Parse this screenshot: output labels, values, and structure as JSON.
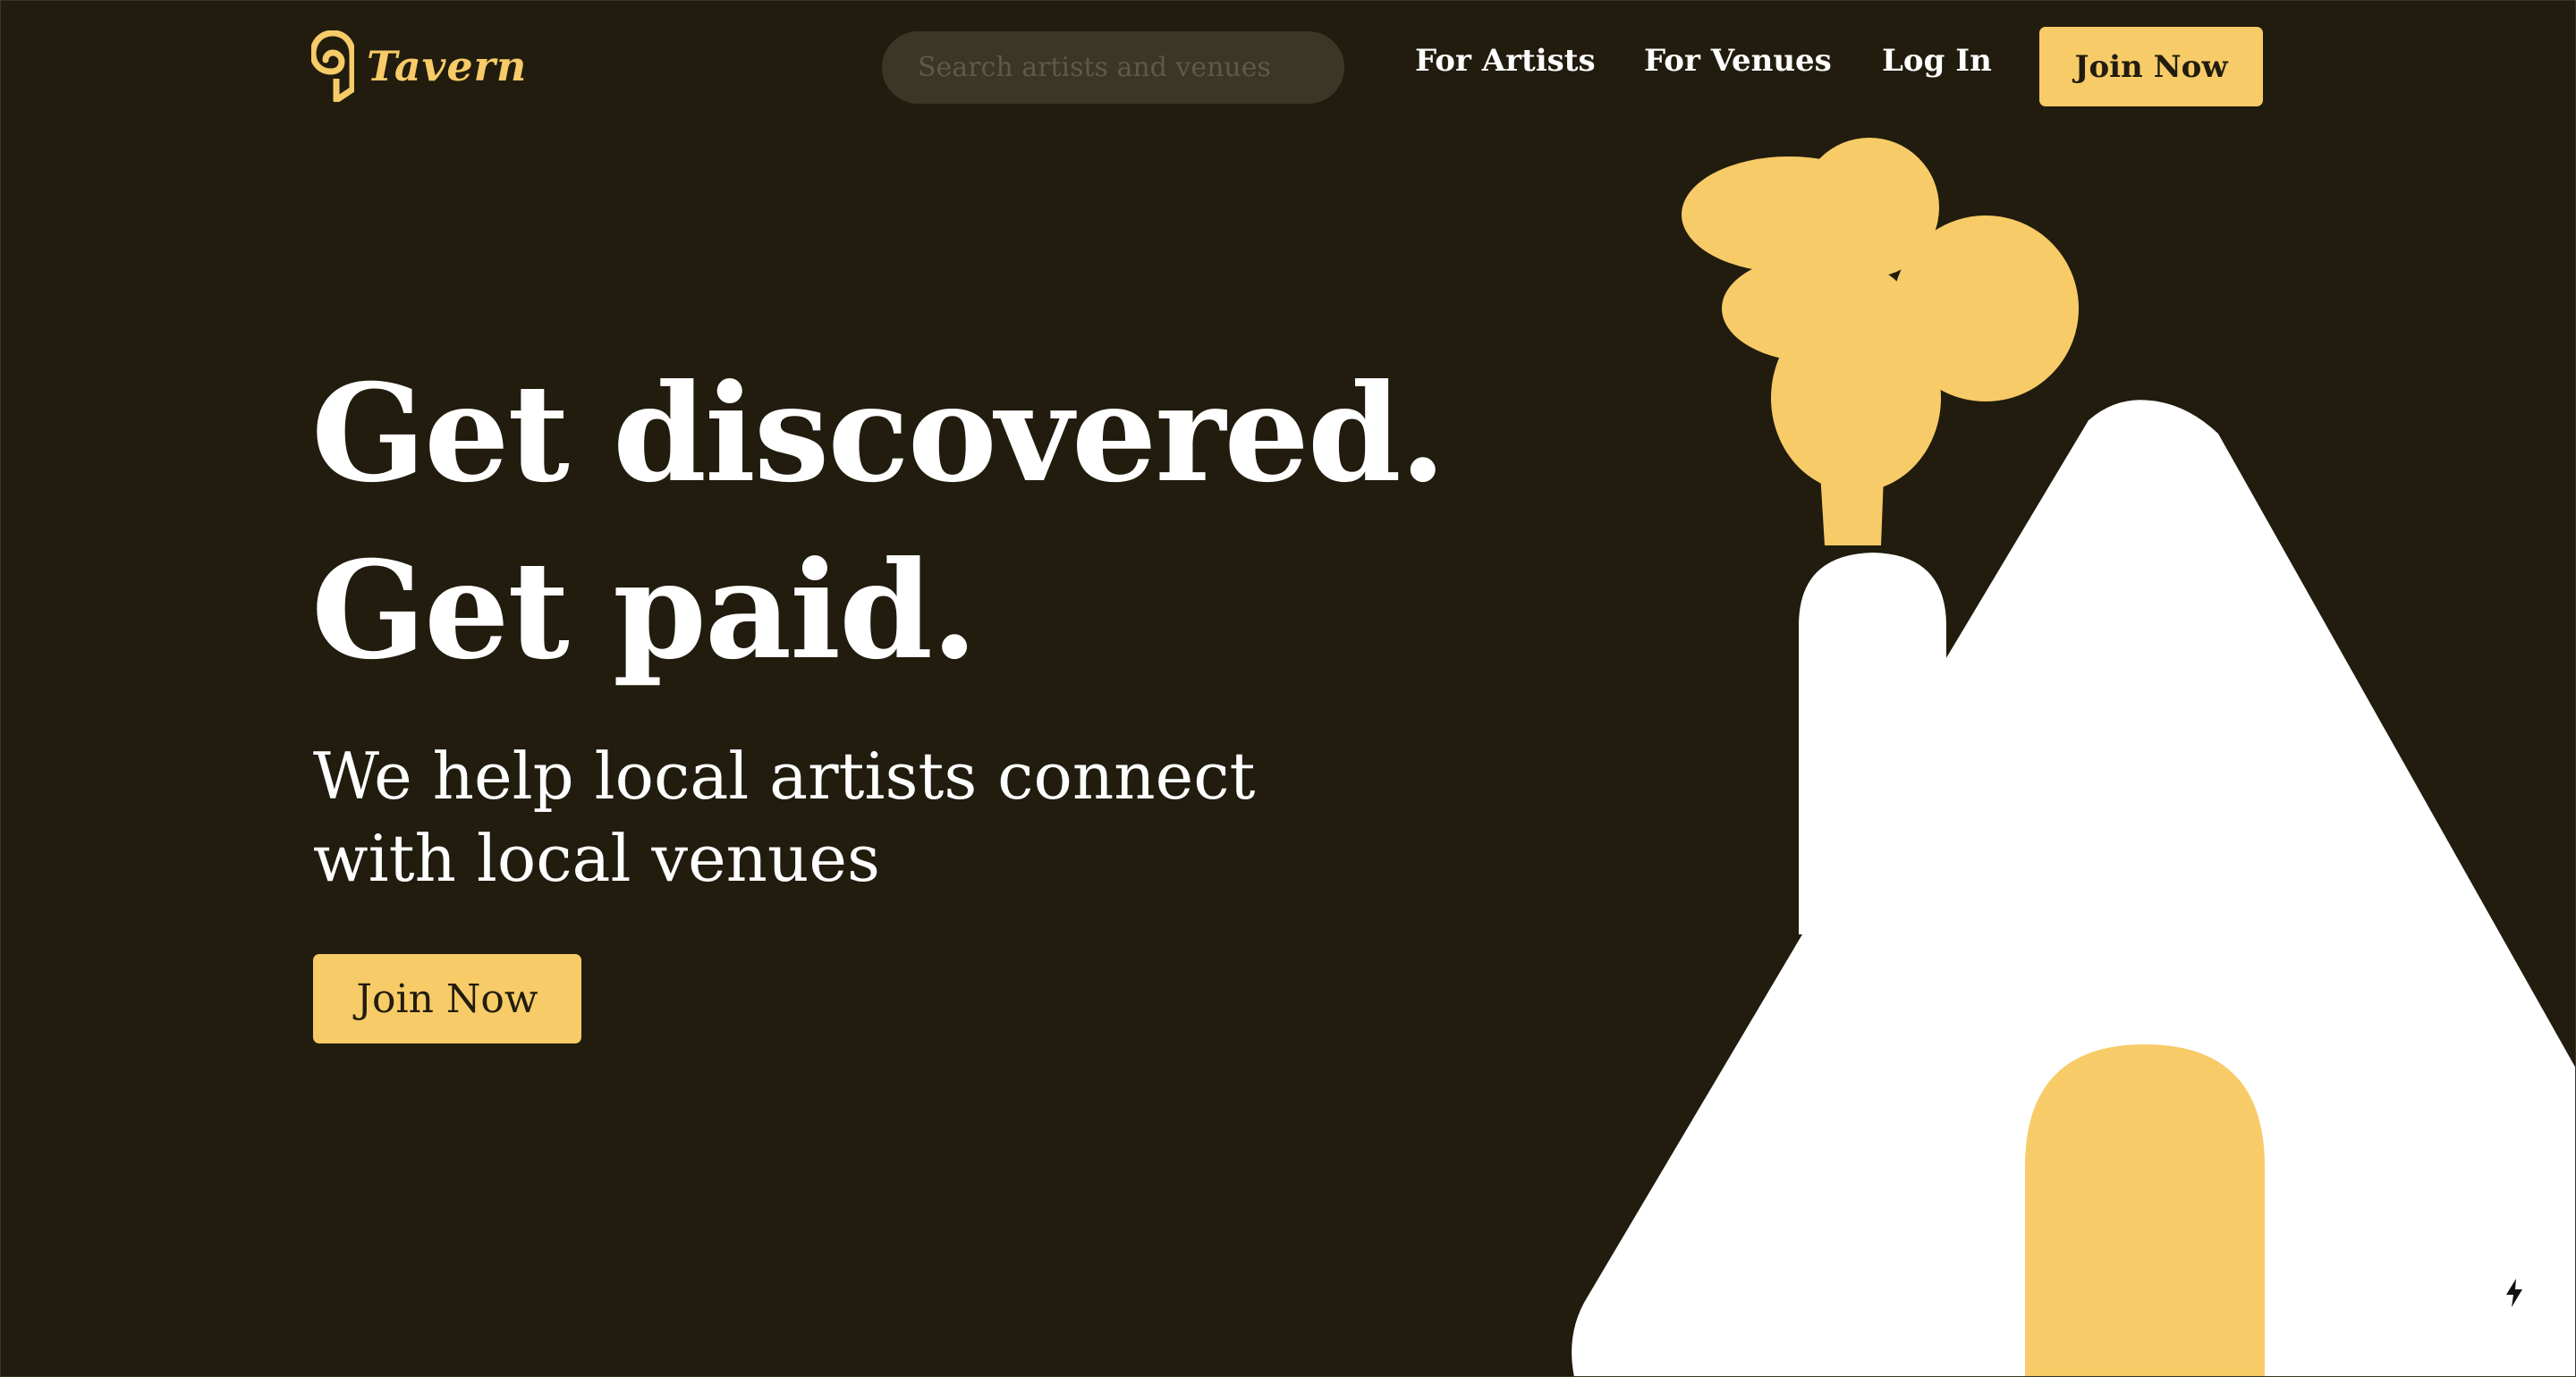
{
  "header": {
    "brand": "Tavern",
    "search_placeholder": "Search artists and venues",
    "nav": {
      "for_artists": "For Artists",
      "for_venues": "For Venues",
      "log_in": "Log In"
    },
    "join_label": "Join Now"
  },
  "hero": {
    "headline_line1": "Get discovered.",
    "headline_line2": "Get paid.",
    "subhead": "We help local artists connect with local venues",
    "cta_label": "Join Now"
  },
  "colors": {
    "background": "#211c0e",
    "accent": "#f7cb67",
    "text": "#ffffff",
    "search_bg": "#3b3727"
  },
  "icons": {
    "logo": "tavern-logo-icon",
    "widget": "lightning-bolt-icon"
  }
}
